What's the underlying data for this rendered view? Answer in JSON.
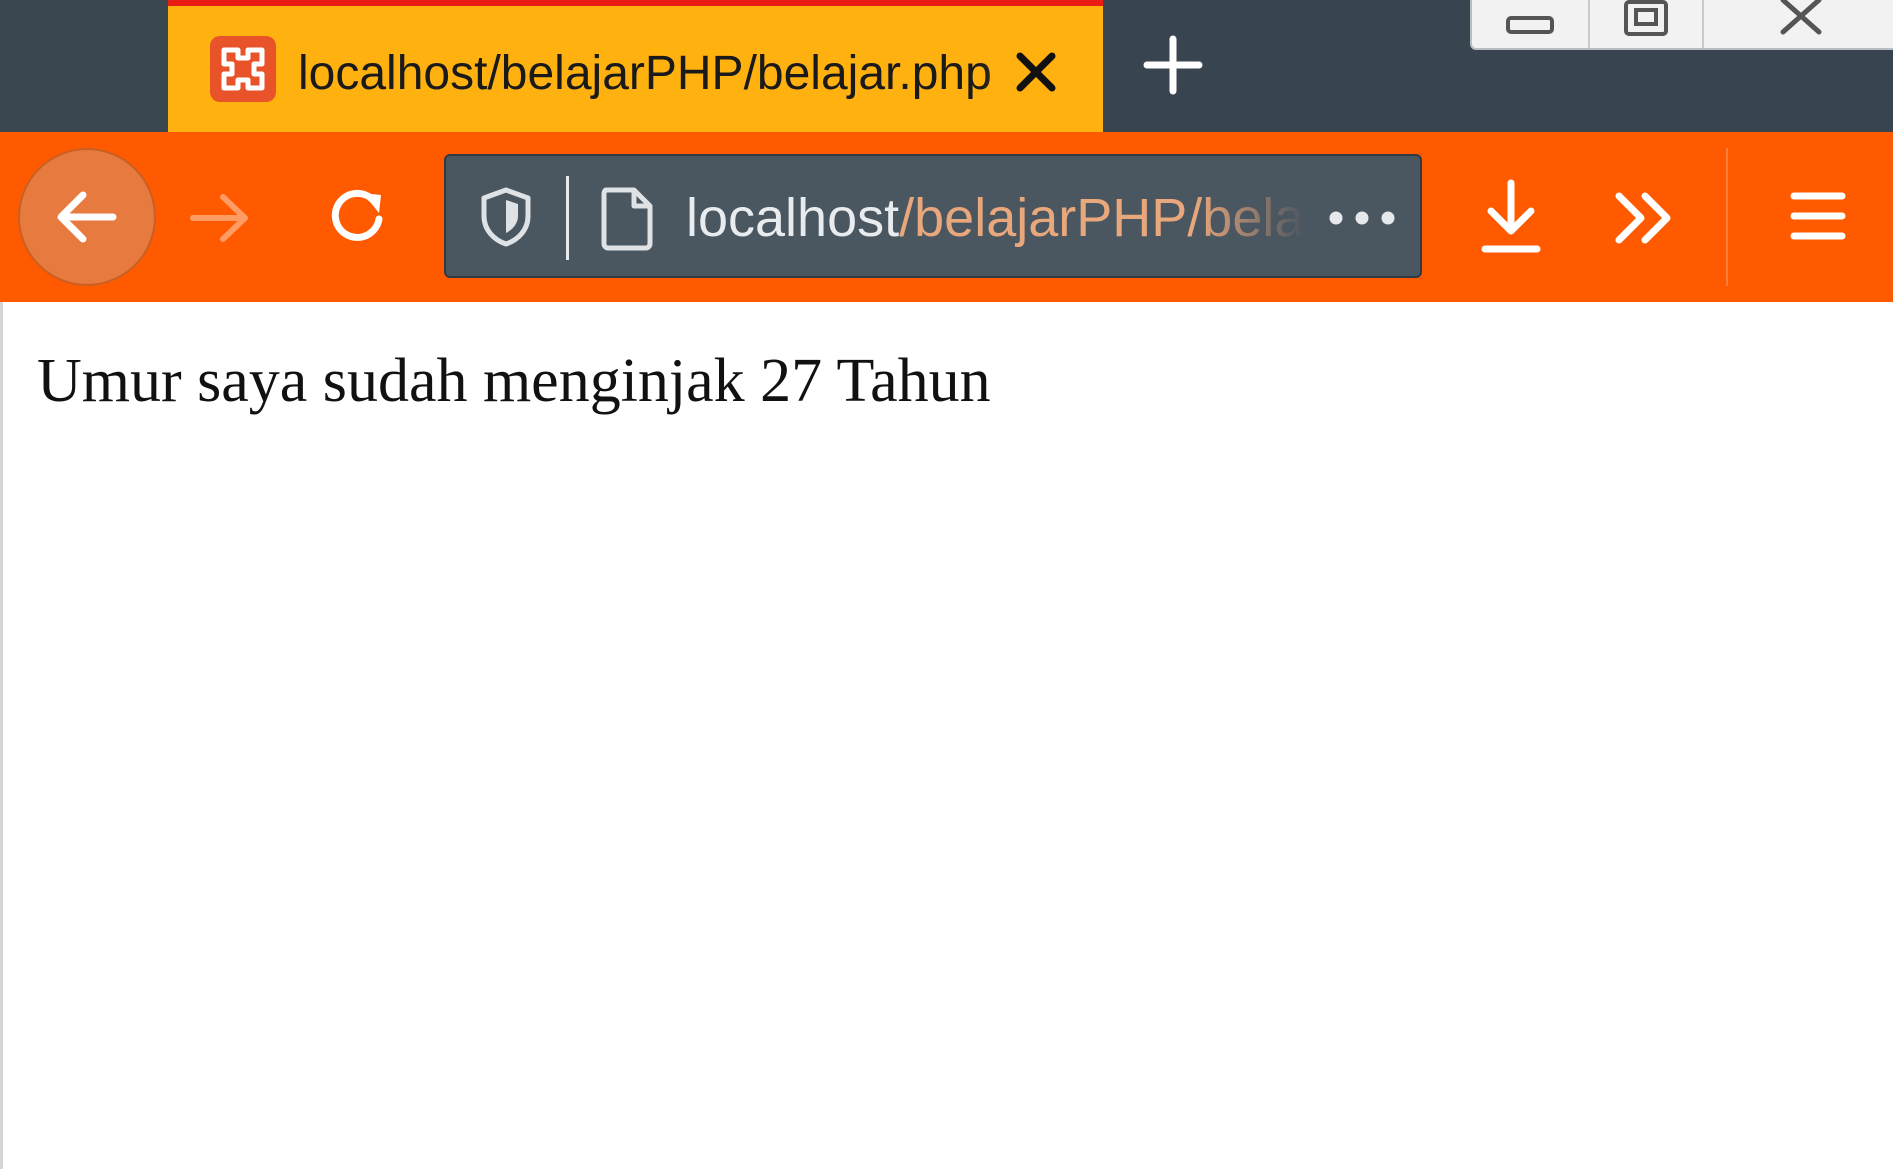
{
  "tab": {
    "title": "localhost/belajarPHP/belajar.php",
    "favicon": "xampp-icon"
  },
  "toolbar": {
    "url_host": "localhost",
    "url_path": "/belajarPHP/belajar.php",
    "icons": [
      "back-arrow-icon",
      "forward-arrow-icon",
      "reload-icon",
      "shield-icon",
      "page-icon",
      "more-dots-icon",
      "download-icon",
      "overflow-chevron-icon",
      "hamburger-menu-icon"
    ]
  },
  "page": {
    "text": "Umur saya sudah menginjak 27 Tahun"
  },
  "colors": {
    "tab_active": "#ffb20f",
    "tab_active_top_border": "#e81c12",
    "toolbar": "#ff5a00",
    "tab_strip": "#38444f",
    "url_bar": "#4a5660",
    "url_path": "#e9a77c"
  }
}
